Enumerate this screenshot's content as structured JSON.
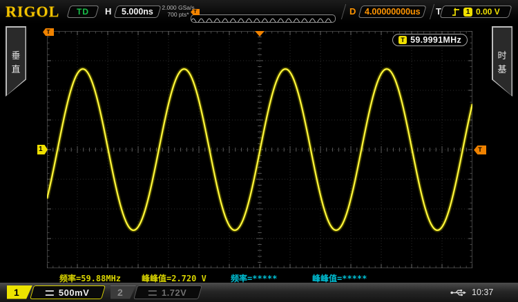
{
  "header": {
    "logo": "RIGOL",
    "acquisition_status": "TD",
    "horizontal_label": "H",
    "timebase": "5.000ns",
    "sample_rate": "2.000 GSa/s",
    "memory_depth": "700 pts*",
    "delay_label": "D",
    "delay_value": "4.00000000us",
    "trigger_label": "T",
    "trigger_source": "1",
    "trigger_level": "0.00 V"
  },
  "side_tabs": {
    "left_char1": "垂",
    "left_char2": "直",
    "right_char1": "时",
    "right_char2": "基"
  },
  "counter": {
    "icon": "T",
    "value": "59.9991MHz"
  },
  "markers": {
    "trigger_position": "T",
    "channel": "1",
    "trigger_level": "T"
  },
  "measurements": [
    {
      "text": "频率=59.88MHz",
      "color": "#d9d400"
    },
    {
      "text": "峰峰值=2.720 V",
      "color": "#d9d400"
    },
    {
      "text": "频率=*****",
      "color": "#00bfd4"
    },
    {
      "text": "峰峰值=*****",
      "color": "#00bfd4"
    }
  ],
  "channel_bar": {
    "ch1": {
      "number": "1",
      "scale": "500mV"
    },
    "ch2": {
      "number": "2",
      "scale": "1.72V"
    },
    "time": "10:37"
  },
  "chart_data": {
    "type": "line",
    "title": "Channel 1 trace",
    "waveform": "sine",
    "frequency_hz": 59999100,
    "frequency_display": "59.9991MHz",
    "measured_frequency_display": "59.88MHz",
    "vpp_v": 2.72,
    "offset_v": 0.0,
    "trigger_level_v": 0.0,
    "timebase_s_per_div": 5e-09,
    "volts_per_div": 0.5,
    "h_divisions": 14,
    "v_divisions": 8,
    "first_peak_at_div": 1.18,
    "trace_color": "#f2e900",
    "grid_on": true,
    "notes": "about 4.2 sine periods visible across 70 ns window"
  }
}
